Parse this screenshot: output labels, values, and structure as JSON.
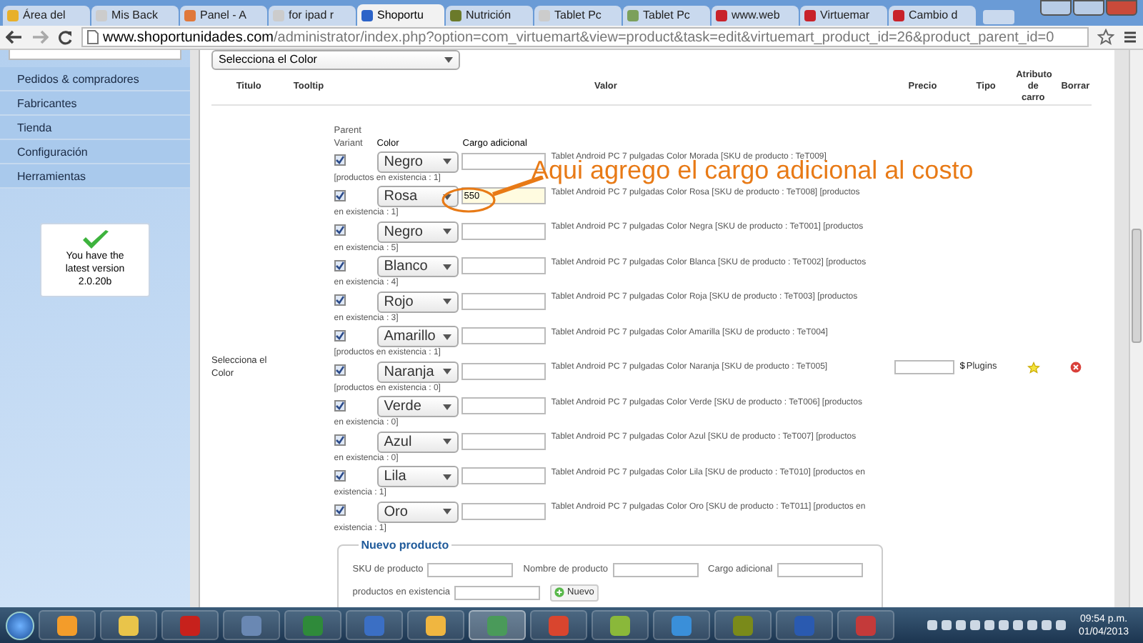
{
  "browser": {
    "tabs": [
      {
        "label": "Área del",
        "selected": false
      },
      {
        "label": "Mis Back",
        "selected": false
      },
      {
        "label": "Panel - A",
        "selected": false
      },
      {
        "label": "for ipad r",
        "selected": false
      },
      {
        "label": "Shoportu",
        "selected": true
      },
      {
        "label": "Nutrición",
        "selected": false
      },
      {
        "label": "Tablet Pc",
        "selected": false
      },
      {
        "label": "Tablet Pc",
        "selected": false
      },
      {
        "label": "www.web",
        "selected": false
      },
      {
        "label": "Virtuemar",
        "selected": false
      },
      {
        "label": "Cambio d",
        "selected": false
      }
    ],
    "address_host": "www.shoportunidades.com",
    "address_path": "/administrator/index.php?option=com_virtuemart&view=product&task=edit&virtuemart_product_id=26&product_parent_id=0"
  },
  "sidebar": {
    "items": [
      "Pedidos & compradores",
      "Fabricantes",
      "Tienda",
      "Configuración",
      "Herramientas"
    ],
    "version_notice": "You have the latest version",
    "version": "2.0.20b"
  },
  "page": {
    "parent_select": "Selecciona el Color",
    "columns": [
      "Titulo",
      "Tooltip",
      "Valor",
      "Precio",
      "Tipo",
      "Atributo de carro",
      "Borrar"
    ],
    "row_title": "Selecciona el Color",
    "variant_headers": {
      "parent_variant": "Parent Variant",
      "option": "Color",
      "charge": "Cargo adicional"
    },
    "variants": [
      {
        "checked": true,
        "option": "Negro",
        "highlighted": false,
        "description": "Tablet Android PC 7 pulgadas Color Morada [SKU de producto : TeT009]",
        "description_end": "[productos en existencia : 1]"
      },
      {
        "checked": true,
        "option": "Rosa",
        "charge": "550",
        "highlighted": true,
        "description": "Tablet Android PC 7 pulgadas Color Rosa [SKU de producto : TeT008] [productos",
        "description_end": "en existencia : 1]"
      },
      {
        "checked": true,
        "option": "Negro",
        "highlighted": false,
        "description": "Tablet Android PC 7 pulgadas Color Negra [SKU de producto : TeT001] [productos",
        "description_end": "en existencia : 5]"
      },
      {
        "checked": true,
        "option": "Blanco",
        "highlighted": false,
        "description": "Tablet Android PC 7 pulgadas Color Blanca [SKU de producto : TeT002] [productos",
        "description_end": "en existencia : 4]"
      },
      {
        "checked": true,
        "option": "Rojo",
        "highlighted": false,
        "description": "Tablet Android PC 7 pulgadas Color Roja [SKU de producto : TeT003] [productos",
        "description_end": "en existencia : 3]"
      },
      {
        "checked": true,
        "option": "Amarillo",
        "highlighted": false,
        "description": "Tablet Android PC 7 pulgadas Color Amarilla [SKU de producto : TeT004]",
        "description_end": "[productos en existencia : 1]"
      },
      {
        "checked": true,
        "option": "Naranja",
        "highlighted": false,
        "description": "Tablet Android PC 7 pulgadas Color Naranja [SKU de producto : TeT005]",
        "description_end": "[productos en existencia : 0]"
      },
      {
        "checked": true,
        "option": "Verde",
        "highlighted": false,
        "description": "Tablet Android PC 7 pulgadas Color Verde [SKU de producto : TeT006] [productos",
        "description_end": "en existencia : 0]"
      },
      {
        "checked": true,
        "option": "Azul",
        "highlighted": false,
        "description": "Tablet Android PC 7 pulgadas Color Azul [SKU de producto : TeT007] [productos",
        "description_end": "en existencia : 0]"
      },
      {
        "checked": true,
        "option": "Lila",
        "highlighted": false,
        "description": "Tablet Android PC 7 pulgadas Color Lila [SKU de producto : TeT010] [productos en",
        "description_end": "existencia : 1]"
      },
      {
        "checked": true,
        "option": "Oro",
        "highlighted": false,
        "description": "Tablet Android PC 7 pulgadas Color Oro [SKU de producto : TeT011] [productos en",
        "description_end": "existencia : 1]"
      }
    ],
    "currency": "$",
    "type": "Plugins",
    "new_product": {
      "legend": "Nuevo producto",
      "fields": [
        "SKU de producto",
        "Nombre de producto",
        "Cargo adicional",
        "productos en existencia"
      ],
      "button": "Nuevo"
    }
  },
  "annotation": "Aqui agrego el cargo adicional al costo",
  "taskbar": {
    "time": "09:54 p.m.",
    "date": "01/04/2013"
  }
}
